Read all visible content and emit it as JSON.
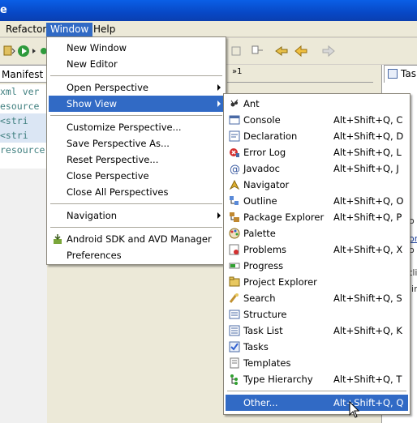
{
  "titlebar": {
    "text": "e"
  },
  "menubar": {
    "refactor": "Refactor",
    "window": "Window",
    "help": "Help"
  },
  "editor": {
    "tab_label": "Manifest",
    "more_label": "»1",
    "code_lines": [
      "xml ver",
      "esource",
      "  <stri",
      "  <stri",
      "resource"
    ]
  },
  "right_view": {
    "tab_label": "Task",
    "frag1": "o",
    "frag2": "or",
    "frag3": "o",
    "frag4": "tli",
    "frag5": "lin"
  },
  "window_menu": {
    "items": [
      {
        "label": "New Window"
      },
      {
        "label": "New Editor"
      },
      {
        "label": "Open Perspective"
      },
      {
        "label": "Show View"
      },
      {
        "label": "Customize Perspective..."
      },
      {
        "label": "Save Perspective As..."
      },
      {
        "label": "Reset Perspective..."
      },
      {
        "label": "Close Perspective"
      },
      {
        "label": "Close All Perspectives"
      },
      {
        "label": "Navigation"
      },
      {
        "label": "Android SDK and AVD Manager"
      },
      {
        "label": "Preferences"
      }
    ]
  },
  "show_view_menu": {
    "items": [
      {
        "label": "Ant",
        "shortcut": "",
        "icon": "ant-icon"
      },
      {
        "label": "Console",
        "shortcut": "Alt+Shift+Q, C",
        "icon": "console-icon"
      },
      {
        "label": "Declaration",
        "shortcut": "Alt+Shift+Q, D",
        "icon": "declaration-icon"
      },
      {
        "label": "Error Log",
        "shortcut": "Alt+Shift+Q, L",
        "icon": "error-log-icon"
      },
      {
        "label": "Javadoc",
        "shortcut": "Alt+Shift+Q, J",
        "icon": "javadoc-icon"
      },
      {
        "label": "Navigator",
        "shortcut": "",
        "icon": "navigator-icon"
      },
      {
        "label": "Outline",
        "shortcut": "Alt+Shift+Q, O",
        "icon": "outline-icon"
      },
      {
        "label": "Package Explorer",
        "shortcut": "Alt+Shift+Q, P",
        "icon": "package-explorer-icon"
      },
      {
        "label": "Palette",
        "shortcut": "",
        "icon": "palette-icon"
      },
      {
        "label": "Problems",
        "shortcut": "Alt+Shift+Q, X",
        "icon": "problems-icon"
      },
      {
        "label": "Progress",
        "shortcut": "",
        "icon": "progress-icon"
      },
      {
        "label": "Project Explorer",
        "shortcut": "",
        "icon": "project-explorer-icon"
      },
      {
        "label": "Search",
        "shortcut": "Alt+Shift+Q, S",
        "icon": "search-icon"
      },
      {
        "label": "Structure",
        "shortcut": "",
        "icon": "structure-icon"
      },
      {
        "label": "Task List",
        "shortcut": "Alt+Shift+Q, K",
        "icon": "task-list-icon"
      },
      {
        "label": "Tasks",
        "shortcut": "",
        "icon": "tasks-icon"
      },
      {
        "label": "Templates",
        "shortcut": "",
        "icon": "templates-icon"
      },
      {
        "label": "Type Hierarchy",
        "shortcut": "Alt+Shift+Q, T",
        "icon": "type-hierarchy-icon"
      },
      {
        "label": "Other...",
        "shortcut": "Alt+Shift+Q, Q",
        "icon": ""
      }
    ]
  },
  "colors": {
    "highlight": "#316ac5",
    "menu_bg": "#ffffff",
    "menubar_bg": "#ece9d8"
  }
}
